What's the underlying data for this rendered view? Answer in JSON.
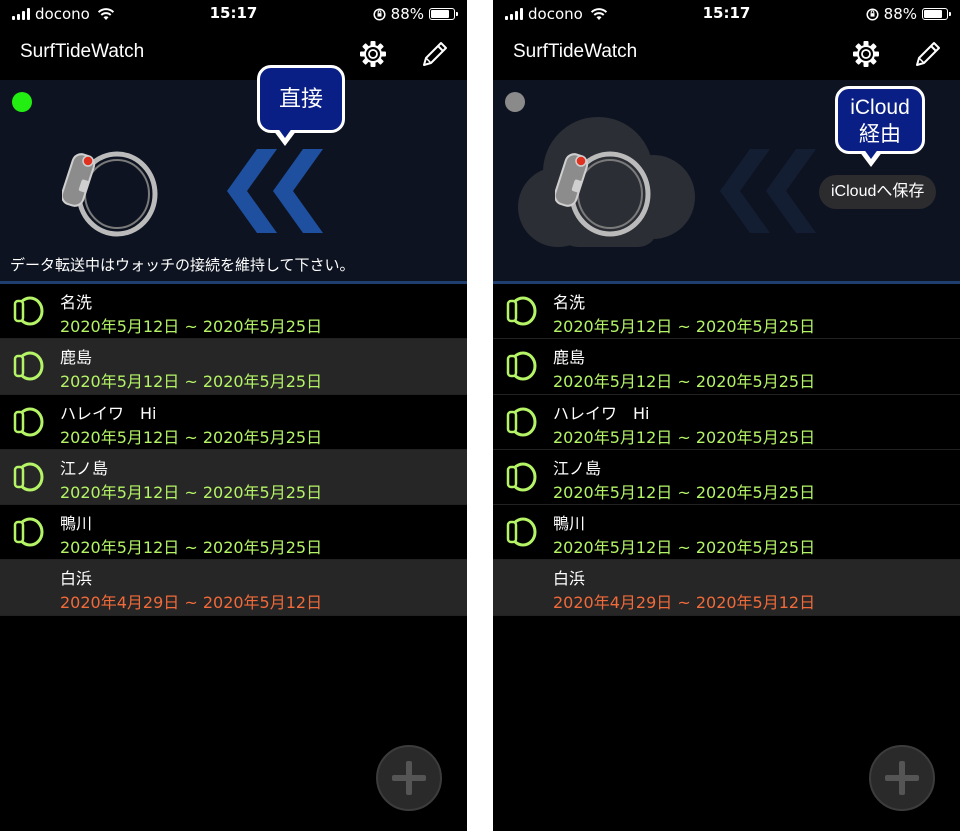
{
  "colors": {
    "background": "#000000",
    "banner": "#0d1320",
    "banner_line": "#1f3f70",
    "date_active": "#b4f466",
    "date_expired": "#f06a3a",
    "balloon": "#0a1f86",
    "connected_dot": "#22ee11",
    "disconnected_dot": "#8a8a8a",
    "chevron_active": "#1f4f9f",
    "chevron_inactive": "#141e33"
  },
  "icons": {
    "settings": "gear-icon",
    "edit": "pencil-icon",
    "watch": "apple-watch-icon",
    "row": "watch-ring-icon",
    "add": "plus-icon",
    "cloud": "cloud-icon",
    "transfer": "double-chevron-left-icon"
  },
  "left": {
    "status": {
      "carrier": "docono",
      "time": "15:17",
      "battery": "88%",
      "battery_level": 0.88
    },
    "title": "SurfTideWatch",
    "balloon": {
      "lines": [
        "直接"
      ]
    },
    "banner_message": "データ転送中はウォッチの接続を維持して下さい。",
    "rows": [
      {
        "name": "名洗",
        "dates": "2020年5月12日 ~ 2020年5月25日",
        "has_icon": true,
        "expired": false
      },
      {
        "name": "鹿島",
        "dates": "2020年5月12日 ~ 2020年5月25日",
        "has_icon": true,
        "expired": false
      },
      {
        "name": "ハレイワ　Hi",
        "dates": "2020年5月12日 ~ 2020年5月25日",
        "has_icon": true,
        "expired": false
      },
      {
        "name": "江ノ島",
        "dates": "2020年5月12日 ~ 2020年5月25日",
        "has_icon": true,
        "expired": false
      },
      {
        "name": "鴨川",
        "dates": "2020年5月12日 ~ 2020年5月25日",
        "has_icon": true,
        "expired": false
      },
      {
        "name": "白浜",
        "dates": "2020年4月29日 ~ 2020年5月12日",
        "has_icon": false,
        "expired": true
      }
    ]
  },
  "right": {
    "status": {
      "carrier": "docono",
      "time": "15:17",
      "battery": "88%",
      "battery_level": 0.88
    },
    "title": "SurfTideWatch",
    "balloon": {
      "lines": [
        "iCloud",
        "経由"
      ]
    },
    "save_button": "iCloudへ保存",
    "rows": [
      {
        "name": "名洗",
        "dates": "2020年5月12日 ~ 2020年5月25日",
        "has_icon": true,
        "expired": false
      },
      {
        "name": "鹿島",
        "dates": "2020年5月12日 ~ 2020年5月25日",
        "has_icon": true,
        "expired": false
      },
      {
        "name": "ハレイワ　Hi",
        "dates": "2020年5月12日 ~ 2020年5月25日",
        "has_icon": true,
        "expired": false
      },
      {
        "name": "江ノ島",
        "dates": "2020年5月12日 ~ 2020年5月25日",
        "has_icon": true,
        "expired": false
      },
      {
        "name": "鴨川",
        "dates": "2020年5月12日 ~ 2020年5月25日",
        "has_icon": true,
        "expired": false
      },
      {
        "name": "白浜",
        "dates": "2020年4月29日 ~ 2020年5月12日",
        "has_icon": false,
        "expired": true
      }
    ]
  }
}
